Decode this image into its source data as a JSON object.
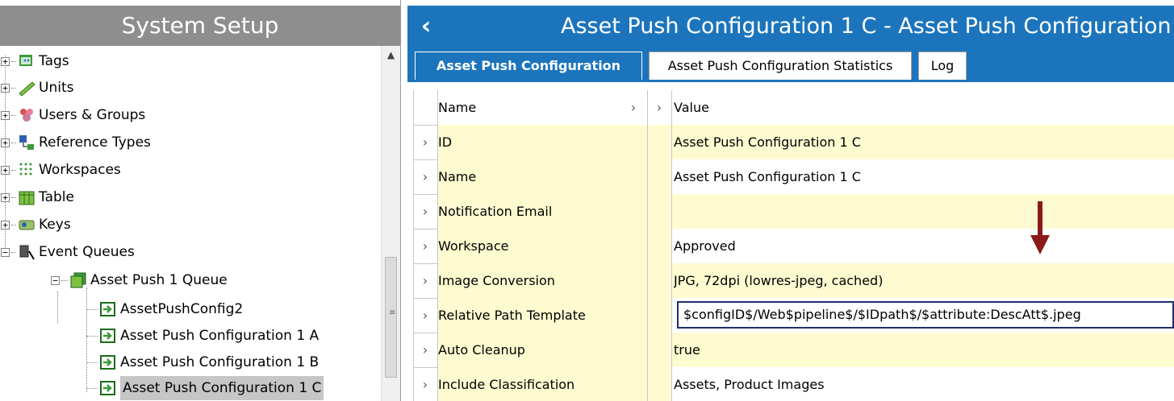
{
  "left_pane": {
    "title": "System Setup",
    "tree": [
      {
        "label": "Tags",
        "icon": "tags-icon",
        "expander": "+"
      },
      {
        "label": "Units",
        "icon": "units-icon",
        "expander": "+"
      },
      {
        "label": "Users & Groups",
        "icon": "users-groups-icon",
        "expander": "+"
      },
      {
        "label": "Reference Types",
        "icon": "reference-types-icon",
        "expander": "+"
      },
      {
        "label": "Workspaces",
        "icon": "workspaces-icon",
        "expander": "+"
      },
      {
        "label": "Table",
        "icon": "table-icon",
        "expander": "+"
      },
      {
        "label": "Keys",
        "icon": "keys-icon",
        "expander": "+"
      },
      {
        "label": "Event Queues",
        "icon": "event-queues-icon",
        "expander": "−"
      },
      {
        "label": "Asset Push 1 Queue",
        "icon": "queue-icon",
        "expander": "−"
      },
      {
        "label": "AssetPushConfig2",
        "icon": "asset-push-config-icon"
      },
      {
        "label": "Asset Push Configuration 1 A",
        "icon": "asset-push-config-icon"
      },
      {
        "label": "Asset Push Configuration 1 B",
        "icon": "asset-push-config-icon"
      },
      {
        "label": "Asset Push Configuration 1 C",
        "icon": "asset-push-config-icon",
        "selected": true
      }
    ]
  },
  "right_pane": {
    "title": "Asset Push Configuration 1 C - Asset Push Configuration",
    "back_icon": "back-chevron-icon",
    "tabs": [
      {
        "label": "Asset Push Configuration",
        "active": true
      },
      {
        "label": "Asset Push Configuration Statistics"
      },
      {
        "label": "Log"
      }
    ],
    "grid": {
      "header": {
        "name": "Name",
        "value": "Value"
      },
      "rows": [
        {
          "name": "ID",
          "value": "Asset Push Configuration 1 C"
        },
        {
          "name": "Name",
          "value": "Asset Push Configuration 1 C"
        },
        {
          "name": "Notification Email",
          "value": ""
        },
        {
          "name": "Workspace",
          "value": "Approved"
        },
        {
          "name": "Image Conversion",
          "value": "JPG, 72dpi (lowres-jpeg, cached)"
        },
        {
          "name": "Relative Path Template",
          "value": "$configID$/Web$pipeline$/$IDpath$/$attribute:DescAtt$.jpeg",
          "editing": true
        },
        {
          "name": "Auto Cleanup",
          "value": "true"
        },
        {
          "name": "Include Classification",
          "value": "Assets, Product Images"
        }
      ]
    }
  },
  "colors": {
    "accent": "#1c75bc",
    "row_bg": "#fffbd1",
    "header_gray": "#8e8e8e",
    "annotation_arrow": "#8b1a1a"
  }
}
